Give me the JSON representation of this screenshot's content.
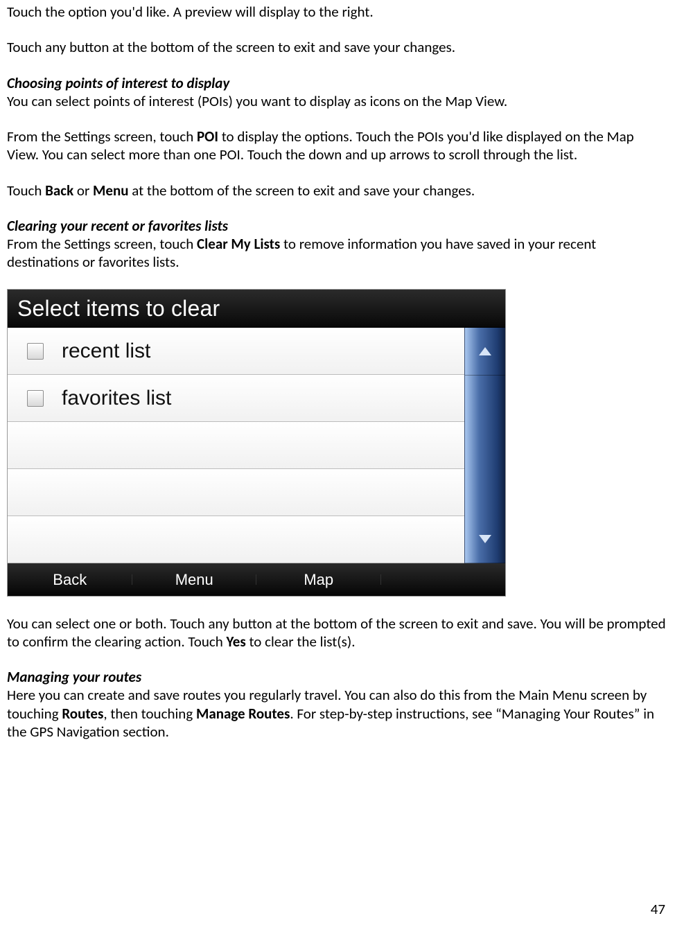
{
  "page_number": "47",
  "paragraphs": {
    "p1": "Touch the option you'd like. A preview will display to the right.",
    "p2": "Touch any button at the bottom of the screen to exit and save your changes.",
    "p5_a": "Touch ",
    "p5_b": "Back",
    "p5_c": " or ",
    "p5_d": "Menu",
    "p5_e": " at the bottom of the screen to exit and save your changes."
  },
  "sections": {
    "poi": {
      "heading": "Choosing points of interest to display",
      "body1": "You can select points of interest (POIs) you want to display as icons on the Map View.",
      "body2_a": "From the Settings screen, touch ",
      "body2_b": "POI",
      "body2_c": " to display the options. Touch the POIs you'd like displayed on the Map View. You can select more than one POI. Touch the down and up arrows to scroll through the list."
    },
    "clear": {
      "heading": "Clearing your recent or favorites lists",
      "body1_a": "From the Settings screen, touch ",
      "body1_b": "Clear My Lists",
      "body1_c": " to remove information you have saved in your recent destinations or favorites lists.",
      "body2_a": "You can select one or both. Touch any button at the bottom of the screen to exit and save. You will be prompted to confirm the clearing action. Touch ",
      "body2_b": "Yes",
      "body2_c": " to clear the list(s)."
    },
    "routes": {
      "heading": "Managing your routes",
      "body_a": "Here you can create and save routes you regularly travel. You can also do this from the Main Menu screen by touching ",
      "body_b": "Routes",
      "body_c": ", then touching ",
      "body_d": "Manage Routes",
      "body_e": ". For step-by-step instructions, see “Managing Your Routes” in the GPS Navigation section."
    }
  },
  "screenshot": {
    "title": "Select items to clear",
    "items": [
      {
        "label": "recent list",
        "checked": false
      },
      {
        "label": "favorites list",
        "checked": false
      }
    ],
    "bottom_buttons": [
      "Back",
      "Menu",
      "Map",
      ""
    ]
  }
}
